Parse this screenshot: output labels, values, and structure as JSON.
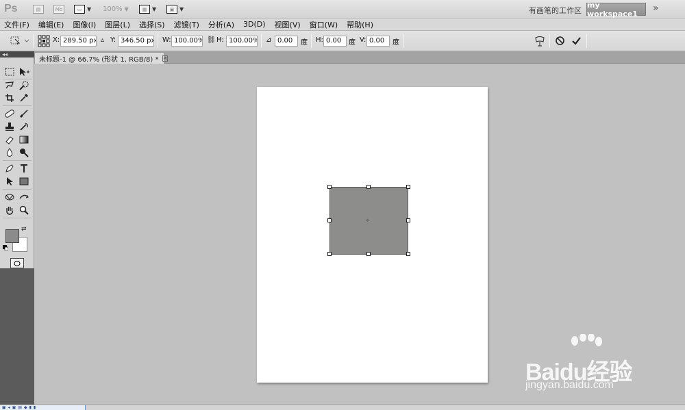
{
  "app": {
    "logo": "Ps",
    "bridge_icon_label": "Mb",
    "zoom": "100%",
    "workspace_label": "有画笔的工作区",
    "workspace_button": "my workspace1",
    "more": "»"
  },
  "menu": [
    "文件(F)",
    "编辑(E)",
    "图像(I)",
    "图层(L)",
    "选择(S)",
    "滤镜(T)",
    "分析(A)",
    "3D(D)",
    "视图(V)",
    "窗口(W)",
    "帮助(H)"
  ],
  "options": {
    "x_label": "X:",
    "x_value": "289.50 px",
    "y_label": "Y:",
    "y_value": "346.50 px",
    "w_label": "W:",
    "w_value": "100.00%",
    "h_label": "H:",
    "h_value": "100.00%",
    "rotate_value": "0.00",
    "degree_unit": "度",
    "hskew_label": "H:",
    "hskew_value": "0.00",
    "vskew_label": "V:",
    "vskew_value": "0.00"
  },
  "document": {
    "tab_title": "未标题-1 @ 66.7% (形状 1, RGB/8) *",
    "tab_close": "×"
  },
  "colors": {
    "foreground": "#8b8b8b",
    "background": "#ffffff",
    "shape_fill": "#8d8e8b"
  },
  "watermark": {
    "brand": "Bai",
    "brand_suffix": "du经验",
    "url": "jingyan.baidu.com"
  },
  "toolbar_collapse": "◂◂"
}
